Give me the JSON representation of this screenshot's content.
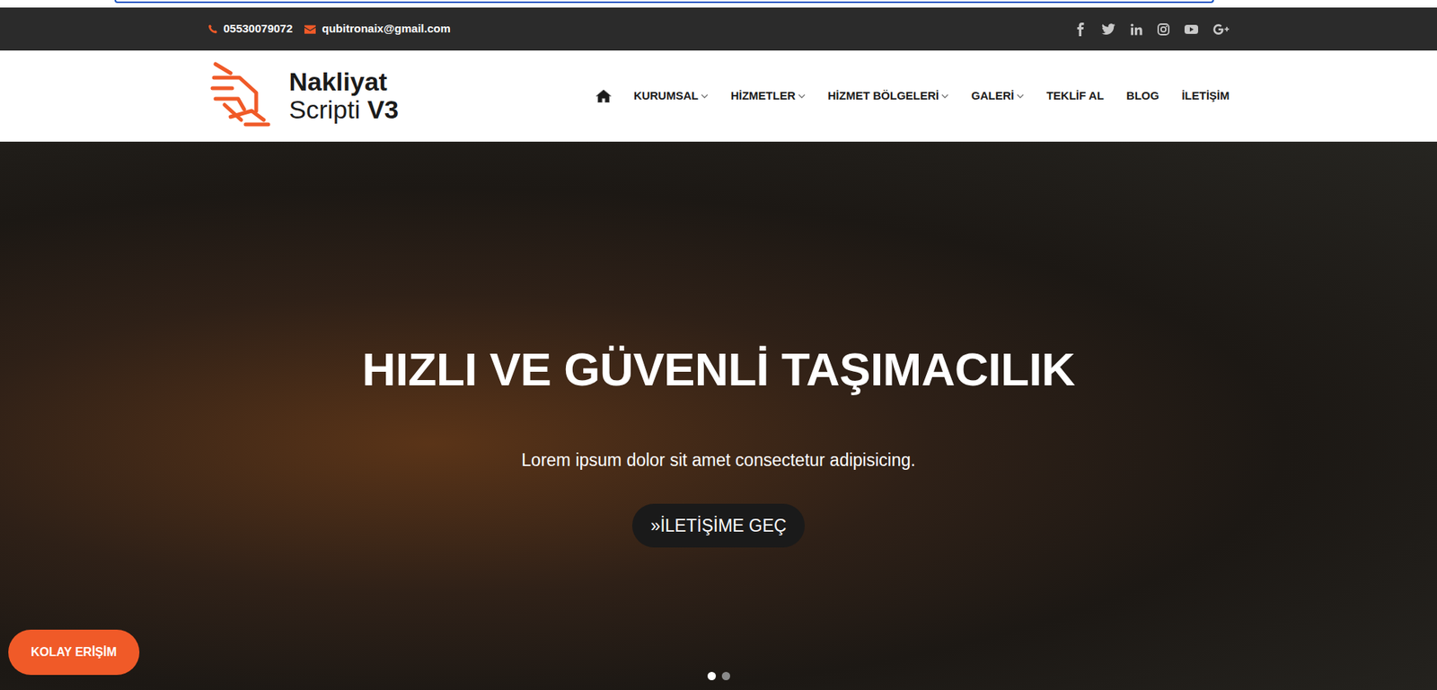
{
  "topbar": {
    "phone": "05530079072",
    "email": "qubitronaix@gmail.com",
    "socials": [
      {
        "kind": "facebook"
      },
      {
        "kind": "twitter"
      },
      {
        "kind": "linkedin"
      },
      {
        "kind": "instagram"
      },
      {
        "kind": "youtube"
      },
      {
        "kind": "googleplus"
      }
    ]
  },
  "logo": {
    "line1": "Nakliyat",
    "line2": "Scripti",
    "badge": "V3"
  },
  "nav": [
    {
      "label": "KURUMSAL",
      "dropdown": true
    },
    {
      "label": "HİZMETLER",
      "dropdown": true
    },
    {
      "label": "HİZMET BÖLGELERİ",
      "dropdown": true
    },
    {
      "label": "GALERİ",
      "dropdown": true
    },
    {
      "label": "TEKLİF AL",
      "dropdown": false
    },
    {
      "label": "BLOG",
      "dropdown": false
    },
    {
      "label": "İLETİŞİM",
      "dropdown": false
    }
  ],
  "hero": {
    "title": "HIZLI VE GÜVENLİ TAŞIMACILIK",
    "subtitle": "Lorem ipsum dolor sit amet consectetur adipisicing.",
    "button": "»İLETİŞİME GEÇ",
    "slides": [
      {
        "selected": true
      },
      {
        "selected": false
      }
    ]
  },
  "accessibility_button": "KOLAY ERİŞİM"
}
